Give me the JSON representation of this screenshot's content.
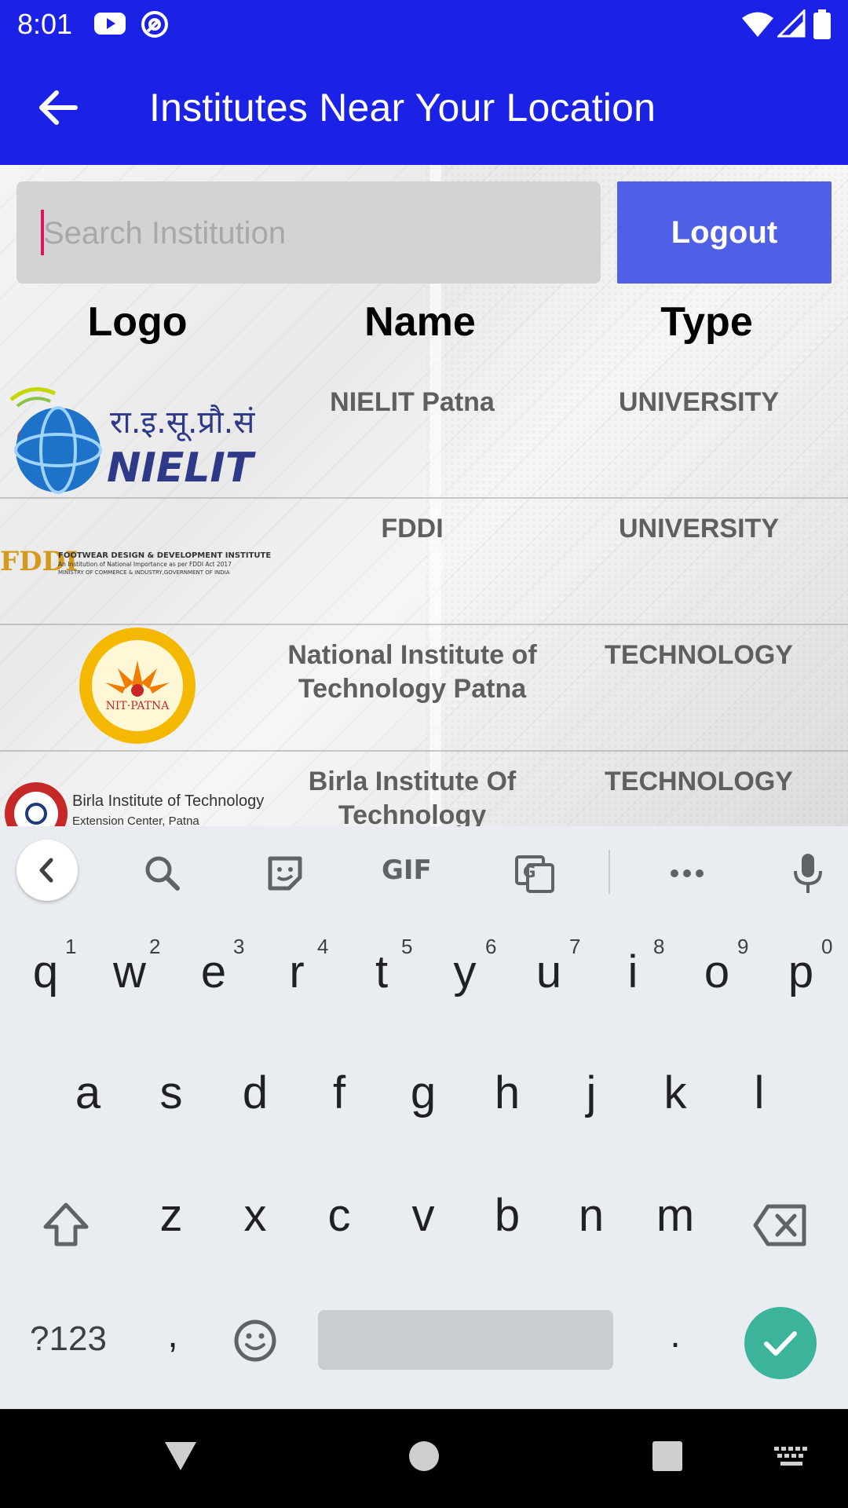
{
  "status_bar": {
    "time": "8:01",
    "left_icons": [
      "youtube-icon",
      "at-icon"
    ],
    "right_icons": [
      "wifi-icon",
      "signal-icon",
      "battery-icon"
    ],
    "color": "#1b22e6"
  },
  "app_bar": {
    "title": "Institutes Near Your Location",
    "back_icon": "arrow-back-icon",
    "color": "#1b22e6"
  },
  "search": {
    "placeholder": "Search Institution",
    "value": ""
  },
  "logout": {
    "label": "Logout",
    "color": "#4f5fe6"
  },
  "table": {
    "headers": [
      "Logo",
      "Name",
      "Type"
    ],
    "rows": [
      {
        "logo": "NIELIT",
        "logo_script": "रा.इ.सू.प्रौ.सं",
        "name": "NIELIT Patna",
        "type": "UNIVERSITY"
      },
      {
        "logo": "FDDI",
        "logo_lines": [
          "FOOTWEAR DESIGN & DEVELOPMENT INSTITUTE",
          "An Institution of National Importance as per FDDI Act 2017",
          "MINISTRY OF COMMERCE & INDUSTRY,GOVERNMENT OF INDIA"
        ],
        "name": "FDDI",
        "type": "UNIVERSITY"
      },
      {
        "logo": "NIT·PATNA",
        "name": "National Institute of Technology Patna",
        "type": "TECHNOLOGY"
      },
      {
        "logo": "Birla Institute of Technology",
        "logo_sub": "Extension Center, Patna",
        "name": "Birla Institute Of Technology",
        "type": "TECHNOLOGY"
      }
    ]
  },
  "keyboard": {
    "toolbar": [
      "chevron-left-icon",
      "search-icon",
      "sticker-icon",
      "GIF",
      "translate-icon",
      "more-icon",
      "mic-icon"
    ],
    "row1": [
      "q",
      "w",
      "e",
      "r",
      "t",
      "y",
      "u",
      "i",
      "o",
      "p"
    ],
    "row1_hints": [
      "1",
      "2",
      "3",
      "4",
      "5",
      "6",
      "7",
      "8",
      "9",
      "0"
    ],
    "row2": [
      "a",
      "s",
      "d",
      "f",
      "g",
      "h",
      "j",
      "k",
      "l"
    ],
    "row3": [
      "z",
      "x",
      "c",
      "v",
      "b",
      "n",
      "m"
    ],
    "symbols_label": "?123",
    "comma": ",",
    "period": ".",
    "enter_color": "#3bb49b"
  },
  "nav_bar": {
    "icons": [
      "back-triangle-icon",
      "home-circle-icon",
      "recents-square-icon",
      "keyboard-switch-icon"
    ]
  }
}
